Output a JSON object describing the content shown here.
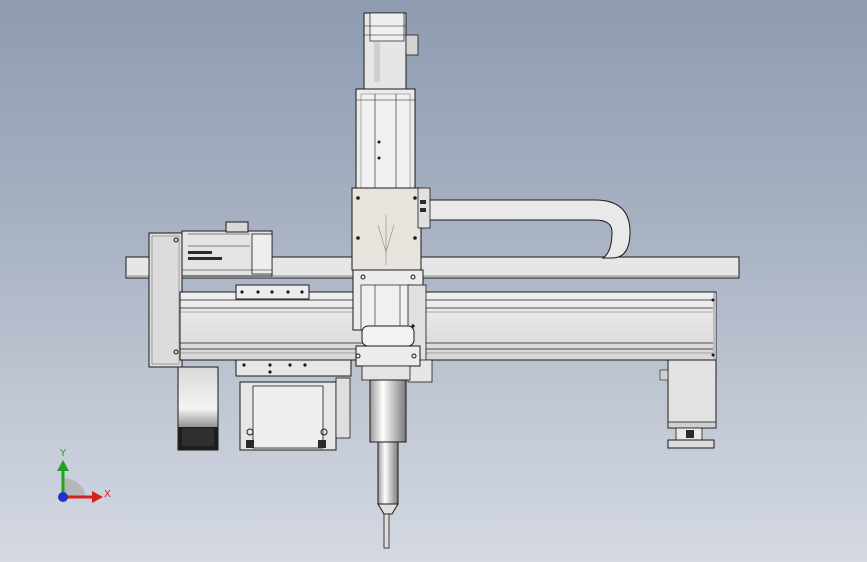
{
  "viewport": {
    "background_top": "#8e9bb0",
    "background_bottom": "#d4d9e2"
  },
  "triad": {
    "x_label": "X",
    "y_label": "Y",
    "x_color": "#d42020",
    "y_color": "#22a022",
    "z_color": "#2030d0"
  },
  "colors": {
    "part_fill": "#e8e8e8",
    "part_light": "#f2f2f2",
    "part_shade": "#c8c8c8",
    "edge": "#1a1a1a",
    "dark": "#2a2a2a"
  },
  "icons": [
    "coordinate-triad-icon"
  ]
}
